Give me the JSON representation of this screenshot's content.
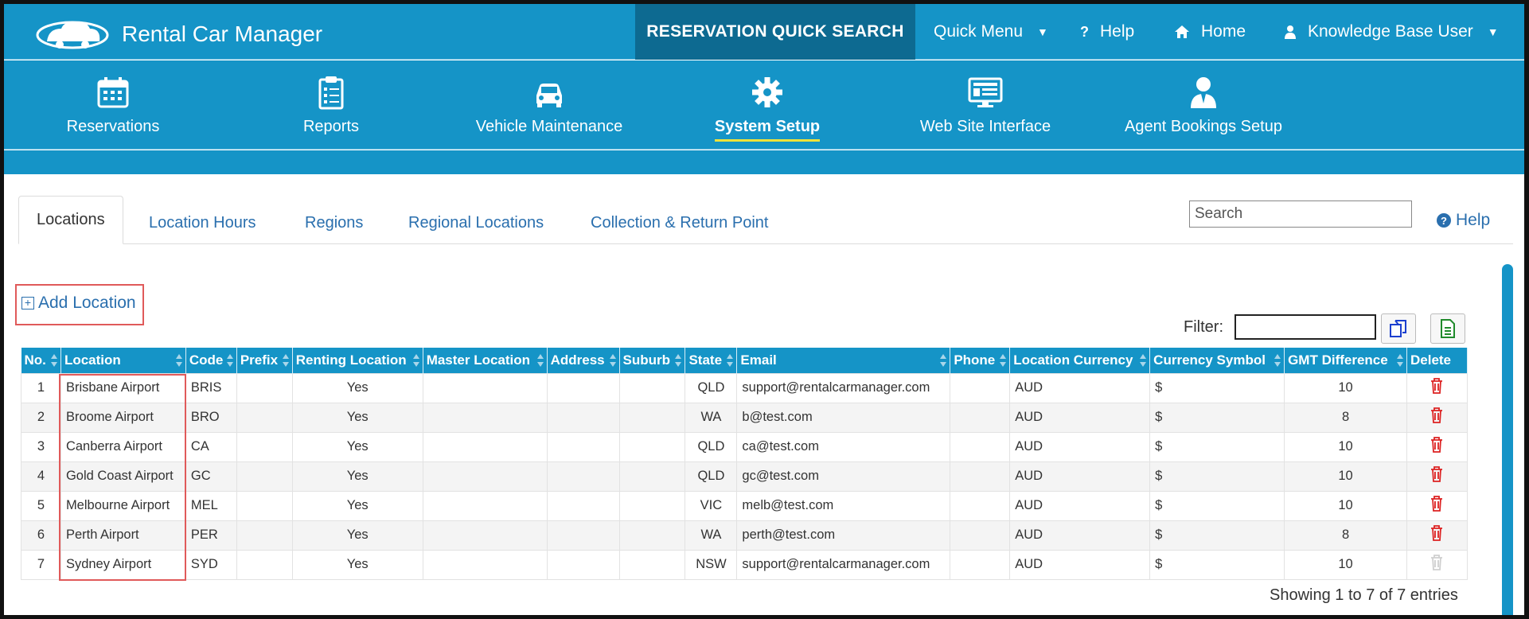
{
  "app": {
    "title": "Rental Car Manager"
  },
  "topbar": {
    "quick_search": "RESERVATION QUICK SEARCH",
    "quick_menu": "Quick Menu",
    "help": "Help",
    "home": "Home",
    "user": "Knowledge Base User"
  },
  "mainnav": {
    "items": [
      {
        "label": "Reservations",
        "icon": "calendar-icon"
      },
      {
        "label": "Reports",
        "icon": "clipboard-icon"
      },
      {
        "label": "Vehicle Maintenance",
        "icon": "car-icon"
      },
      {
        "label": "System Setup",
        "icon": "gear-icon",
        "active": true
      },
      {
        "label": "Web Site Interface",
        "icon": "monitor-icon"
      },
      {
        "label": "Agent Bookings Setup",
        "icon": "agent-icon"
      }
    ]
  },
  "tabs": {
    "items": [
      "Locations",
      "Location Hours",
      "Regions",
      "Regional Locations",
      "Collection & Return Point"
    ],
    "active": "Locations"
  },
  "search": {
    "placeholder": "Search"
  },
  "help_link": "Help",
  "add_location": "Add Location",
  "filter": {
    "label": "Filter:",
    "value": ""
  },
  "table": {
    "columns": [
      "No.",
      "Location",
      "Code",
      "Prefix",
      "Renting Location",
      "Master Location",
      "Address",
      "Suburb",
      "State",
      "Email",
      "Phone",
      "Location Currency",
      "Currency Symbol",
      "GMT Difference",
      "Delete"
    ],
    "rows": [
      {
        "no": "1",
        "location": "Brisbane Airport",
        "code": "BRIS",
        "prefix": "",
        "renting": "Yes",
        "master": "",
        "address": "",
        "suburb": "",
        "state": "QLD",
        "email": "support@rentalcarmanager.com",
        "phone": "",
        "currency": "AUD",
        "symbol": "$",
        "gmt": "10"
      },
      {
        "no": "2",
        "location": "Broome Airport",
        "code": "BRO",
        "prefix": "",
        "renting": "Yes",
        "master": "",
        "address": "",
        "suburb": "",
        "state": "WA",
        "email": "b@test.com",
        "phone": "",
        "currency": "AUD",
        "symbol": "$",
        "gmt": "8"
      },
      {
        "no": "3",
        "location": "Canberra Airport",
        "code": "CA",
        "prefix": "",
        "renting": "Yes",
        "master": "",
        "address": "",
        "suburb": "",
        "state": "QLD",
        "email": "ca@test.com",
        "phone": "",
        "currency": "AUD",
        "symbol": "$",
        "gmt": "10"
      },
      {
        "no": "4",
        "location": "Gold Coast Airport",
        "code": "GC",
        "prefix": "",
        "renting": "Yes",
        "master": "",
        "address": "",
        "suburb": "",
        "state": "QLD",
        "email": "gc@test.com",
        "phone": "",
        "currency": "AUD",
        "symbol": "$",
        "gmt": "10"
      },
      {
        "no": "5",
        "location": "Melbourne Airport",
        "code": "MEL",
        "prefix": "",
        "renting": "Yes",
        "master": "",
        "address": "",
        "suburb": "",
        "state": "VIC",
        "email": "melb@test.com",
        "phone": "",
        "currency": "AUD",
        "symbol": "$",
        "gmt": "10"
      },
      {
        "no": "6",
        "location": "Perth Airport",
        "code": "PER",
        "prefix": "",
        "renting": "Yes",
        "master": "",
        "address": "",
        "suburb": "",
        "state": "WA",
        "email": "perth@test.com",
        "phone": "",
        "currency": "AUD",
        "symbol": "$",
        "gmt": "8"
      },
      {
        "no": "7",
        "location": "Sydney Airport",
        "code": "SYD",
        "prefix": "",
        "renting": "Yes",
        "master": "",
        "address": "",
        "suburb": "",
        "state": "NSW",
        "email": "support@rentalcarmanager.com",
        "phone": "",
        "currency": "AUD",
        "symbol": "$",
        "gmt": "10"
      }
    ]
  },
  "showing": "Showing 1 to 7 of 7 entries",
  "colors": {
    "brand": "#1594c7",
    "brand_dark": "#0d6a91",
    "link": "#2a6fae",
    "delete": "#dd2222",
    "highlight": "#e05a5a",
    "active_underline": "#f1e23a"
  }
}
